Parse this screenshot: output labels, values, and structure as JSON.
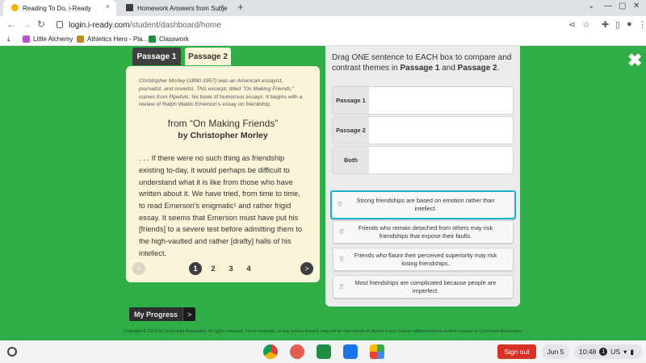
{
  "browser": {
    "tabs": [
      {
        "title": "Reading To Do, i-Ready",
        "close": "×"
      },
      {
        "title": "Homework Answers from Subje",
        "close": "×"
      }
    ],
    "new_tab": "+",
    "window_controls": {
      "dropdown": "⌄",
      "minimize": "—",
      "maximize": "▢",
      "close": "✕"
    },
    "nav": {
      "back": "←",
      "forward": "→",
      "reload": "↻"
    },
    "url_host": "login.i-ready.com",
    "url_path": "/student/dashboard/home",
    "toolbar_icons": {
      "share": "⋖",
      "star": "☆",
      "extensions": "✚",
      "tab_search": "▯",
      "profile": "●",
      "menu": "⋮"
    },
    "bookmarks": [
      {
        "label": "Little Alchemy",
        "icon_color": "#b455c8"
      },
      {
        "label": "Athletics Hero - Pla...",
        "icon_color": "#c48a1e"
      },
      {
        "label": "Classwork",
        "icon_color": "#1e8e3e"
      }
    ],
    "download_icon": "⤓"
  },
  "passage_tabs": [
    "Passage 1",
    "Passage 2"
  ],
  "passage": {
    "intro_italic": "Christopher Morley (1890-1957) was an American essayist, journalist, and novelist. This excerpt, titled \"On Making Friends,\" comes from Pipefuls,",
    "intro_rest": " his book of humorous essays. It begins with a review of Ralph Waldo Emerson's essay on friendship.",
    "title": "from “On Making Friends”",
    "author": "by Christopher Morley",
    "body": ". . . If there were no such thing as friendship existing to-day, it would perhaps be difficult to understand what it is like from those who have written about it. We have tried, from time to time, to read Emerson's enigmatic¹ and rather frigid essay. It seems that Emerson must have put his [friends] to a severe test before admitting them to the high-vaulted and rather [drafty] halls of his intellect."
  },
  "pagination": {
    "prev": "<",
    "next": ">",
    "pages": [
      "1",
      "2",
      "3",
      "4"
    ],
    "current": "1"
  },
  "my_progress": {
    "label": "My Progress",
    "arrow": ">"
  },
  "question": {
    "prompt_a": "Drag ONE sentence to EACH box to compare and contrast themes in ",
    "prompt_b": "Passage 1",
    "prompt_c": " and ",
    "prompt_d": "Passage 2",
    "prompt_e": ".",
    "boxes": [
      "Passage 1",
      "Passage 2",
      "Both"
    ],
    "options": [
      "Strong friendships are based on emotion rather than intellect.",
      "Friends who remain detached from others may risk friendships that expose their faults.",
      "Friends who flaunt their perceived superiority may risk losing friendships.",
      "Most friendships are complicated because people are imperfect."
    ],
    "grip": "⠿"
  },
  "close_glyph": "✖",
  "copyright": "Copyright © 2023 by Curriculum Associates. All rights reserved. These materials, or any portion thereof, may not be reproduced or shared in any manner without express written consent of Curriculum Associates.",
  "shelf": {
    "sign_out": "Sign out",
    "date": "Jun 5",
    "time": "10:48",
    "notifications": "1",
    "locale": "US",
    "wifi": "▾",
    "battery": "▮",
    "apps": [
      {
        "name": "chrome",
        "color": "#db4437"
      },
      {
        "name": "app-red",
        "color": "#e25d4f"
      },
      {
        "name": "classroom",
        "color": "#1e8e3e"
      },
      {
        "name": "files",
        "color": "#1a73e8"
      },
      {
        "name": "play-store",
        "color": "#34a853"
      }
    ]
  },
  "colors": {
    "page_green": "#2fae48",
    "passage_bg": "#faf4d8",
    "selected_border": "#1bb3c9",
    "signout_red": "#d93025"
  }
}
